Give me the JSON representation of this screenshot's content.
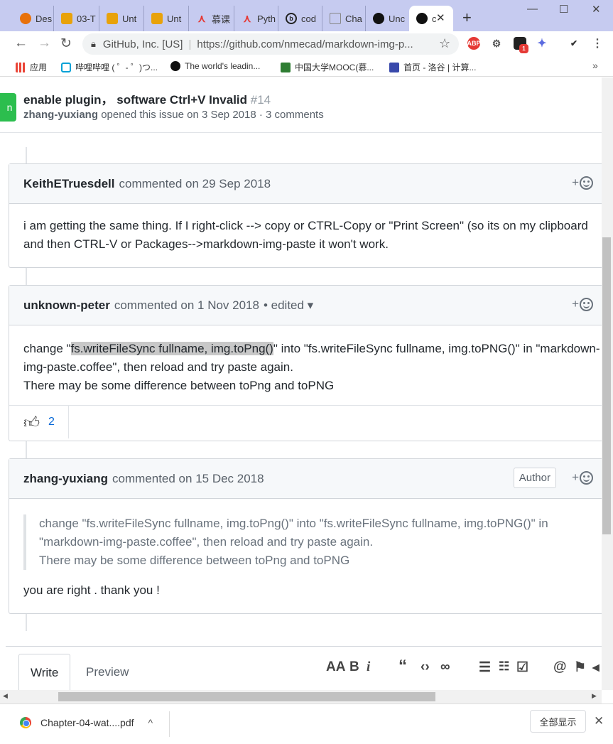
{
  "browser": {
    "tabs": [
      {
        "label": "Des",
        "color": "#e8710a"
      },
      {
        "label": "03-T",
        "color": "#e8a20a"
      },
      {
        "label": "Unt",
        "color": "#e8a20a"
      },
      {
        "label": "Unt",
        "color": "#e8a20a"
      },
      {
        "label": "慕课",
        "color": "#e53935"
      },
      {
        "label": "Pyth",
        "color": "#e53935"
      },
      {
        "label": "cod",
        "color": "#222222"
      },
      {
        "label": "Cha",
        "color": "#888888"
      },
      {
        "label": "Unc",
        "color": "#111111"
      },
      {
        "label": "c",
        "color": "#111111"
      }
    ],
    "active_tab_index": 9,
    "site_identity": "GitHub, Inc. [US]",
    "url": "https://github.com/nmecad/markdown-img-p...",
    "bookmarks": [
      {
        "label": "应用"
      },
      {
        "label": "哔哩哔哩 ( ゜- ゜)つ..."
      },
      {
        "label": "The world's leadin..."
      },
      {
        "label": "中国大学MOOC(慕..."
      },
      {
        "label": "首页 - 洛谷 | 计算..."
      }
    ],
    "ext_badge": "1"
  },
  "issue": {
    "state_glyph": "n",
    "title": "enable plugin， software Ctrl+V Invalid",
    "number": "#14",
    "author": "zhang-yuxiang",
    "meta": "opened this issue on 3 Sep 2018 · 3 comments"
  },
  "comments": [
    {
      "author": "KeithETruesdell",
      "date": "commented on 29 Sep 2018",
      "lines": [
        "i am getting the same thing. If I right-click --> copy or CTRL-Copy or \"Print Screen\" (so its on my clipboard",
        "and then CTRL-V or Packages-->markdown-img-paste it won't work."
      ]
    },
    {
      "author": "unknown-peter",
      "date": "commented on 1 Nov 2018",
      "edited": "• edited ▾",
      "line1_pre": "change \"",
      "line1_hl": "fs.writeFileSync fullname, img.toPng()",
      "line1_post": "\" into \"fs.writeFileSync fullname, img.toPNG()\" in \"markdown-",
      "line2": "img-paste.coffee\", then reload and try paste again.",
      "line3": "There may be some difference between toPng and toPNG",
      "thumbs_count": "2"
    },
    {
      "author": "zhang-yuxiang",
      "date": "commented on 15 Dec 2018",
      "badge": "Author",
      "quote": [
        "change \"fs.writeFileSync fullname, img.toPng()\" into \"fs.writeFileSync fullname, img.toPNG()\" in",
        "\"markdown-img-paste.coffee\", then reload and try paste again.",
        "There may be some difference between toPng and toPNG"
      ],
      "reply": "you are right . thank you !"
    }
  ],
  "editor": {
    "write_tab": "Write",
    "preview_tab": "Preview"
  },
  "downloads": {
    "filename": "Chapter-04-wat....pdf",
    "show_all": "全部显示"
  }
}
